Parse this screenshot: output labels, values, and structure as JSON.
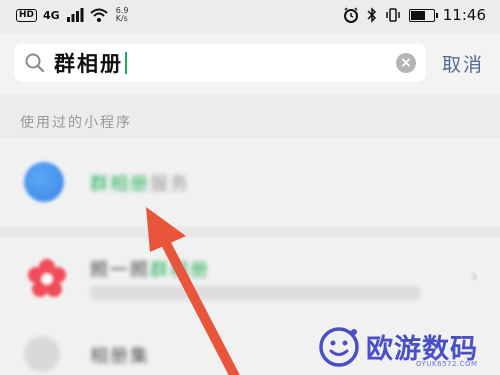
{
  "status_bar": {
    "hd_badge": "HD",
    "signal": "4G",
    "net_speed": "6.9",
    "net_unit": "K/s",
    "time": "11:46"
  },
  "search": {
    "query": "群相册",
    "cancel_label": "取消"
  },
  "section": {
    "recent_miniprograms_label": "使用过的小程序"
  },
  "results": [
    {
      "title_plain": "群相册",
      "title_rest": "服务"
    },
    {
      "title_plain": "照一照",
      "title_highlight": "群相册"
    },
    {
      "title_plain": "相册集"
    }
  ],
  "watermark": {
    "brand": "欧游数码",
    "url": "OYUK6572.COM"
  },
  "colors": {
    "accent_green": "#14b15a",
    "link_blue": "#576b95",
    "arrow_red": "#e8553a",
    "watermark_purple": "#4a4fc8"
  }
}
